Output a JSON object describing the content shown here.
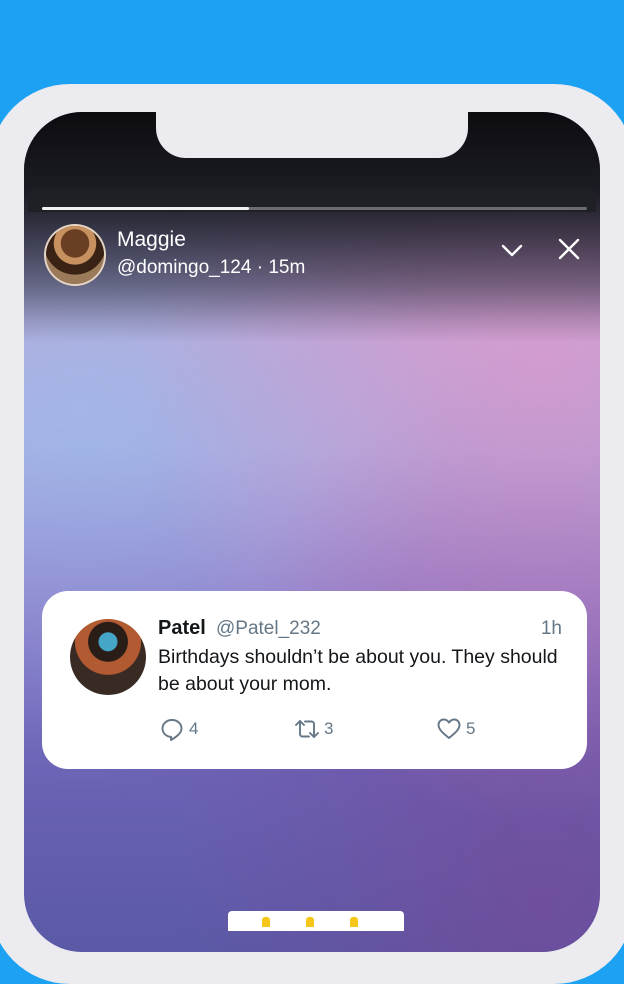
{
  "colors": {
    "background": "#1da1f2",
    "card": "#ffffff",
    "secondary_text": "#657786"
  },
  "story": {
    "progress": 0.38,
    "user": {
      "name": "Maggie",
      "meta": "@domingo_124 · 15m"
    },
    "icons": {
      "collapse": "chevron-down-icon",
      "close": "close-icon"
    }
  },
  "tweet": {
    "author": "Patel",
    "handle": "@Patel_232",
    "time": "1h",
    "text": "Birthdays shouldn’t be about you. They should be about your mom.",
    "actions": {
      "replies": "4",
      "retweets": "3",
      "likes": "5"
    }
  }
}
